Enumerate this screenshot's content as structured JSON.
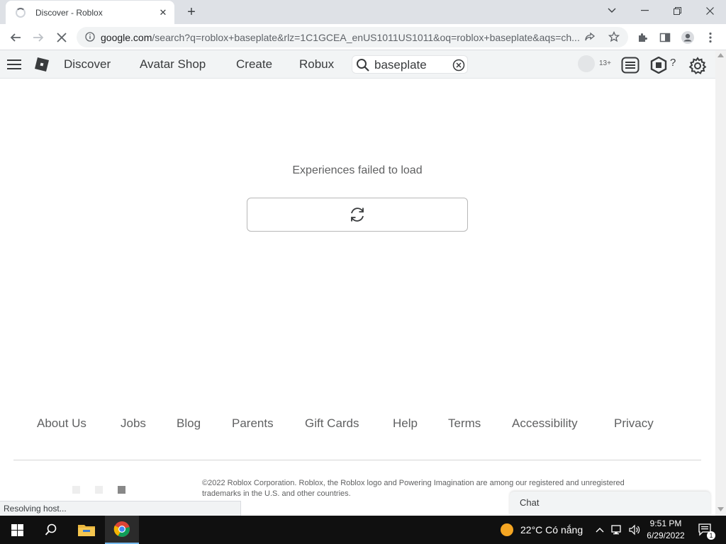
{
  "browser": {
    "tab_title": "Discover - Roblox",
    "url_host": "google.com",
    "url_path": "/search?q=roblox+baseplate&rlz=1C1GCEA_enUS1011US1011&oq=roblox+baseplate&aqs=ch...",
    "status_text": "Resolving host..."
  },
  "header": {
    "nav": [
      "Discover",
      "Avatar Shop",
      "Create",
      "Robux"
    ],
    "search_value": "baseplate",
    "age_badge": "13+",
    "robux_label": "?"
  },
  "main": {
    "error_message": "Experiences failed to load"
  },
  "footer": {
    "links": [
      "About Us",
      "Jobs",
      "Blog",
      "Parents",
      "Gift Cards",
      "Help",
      "Terms",
      "Accessibility",
      "Privacy"
    ],
    "copyright_line1": "©2022 Roblox Corporation. Roblox, the Roblox logo and Powering Imagination are among our registered and unregistered",
    "copyright_line2": "trademarks in the U.S. and other countries."
  },
  "chat": {
    "label": "Chat"
  },
  "taskbar": {
    "weather": "22°C  Có nắng",
    "time": "9:51 PM",
    "date": "6/29/2022",
    "notifications": "1"
  },
  "colors": {
    "header_bg": "#f2f4f5",
    "text_dark": "#393b3d",
    "text_gray": "#606162",
    "taskbar_bg": "#101010"
  }
}
